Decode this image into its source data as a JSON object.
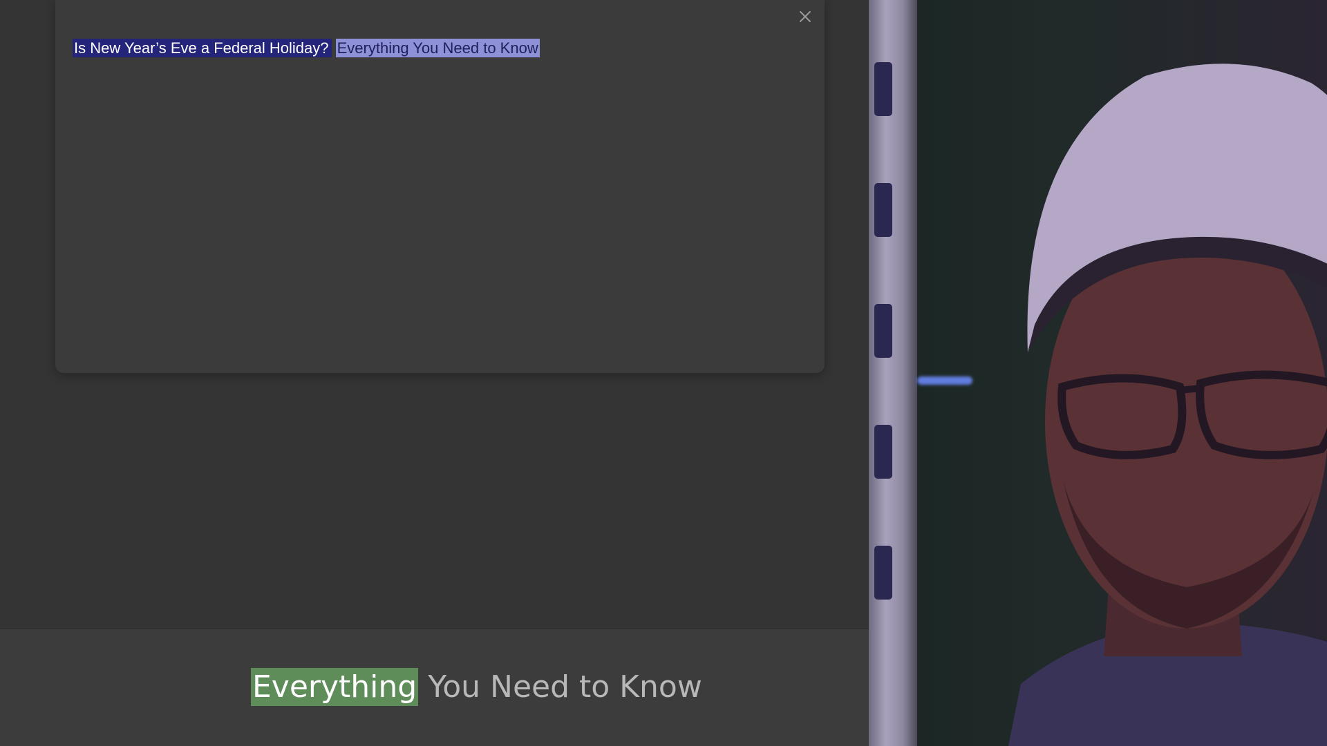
{
  "teleprompter": {
    "script_spoken": "Is New Year’s Eve a Federal Holiday?",
    "script_upcoming": "Everything You Need to Know",
    "close_icon": "close-icon"
  },
  "caption": {
    "current_word": "Everything",
    "remaining": "You Need to Know"
  },
  "colors": {
    "spoken_highlight": "#24247a",
    "upcoming_highlight": "#8e90d8",
    "caption_highlight": "#5f8d5a",
    "background": "#343434"
  }
}
